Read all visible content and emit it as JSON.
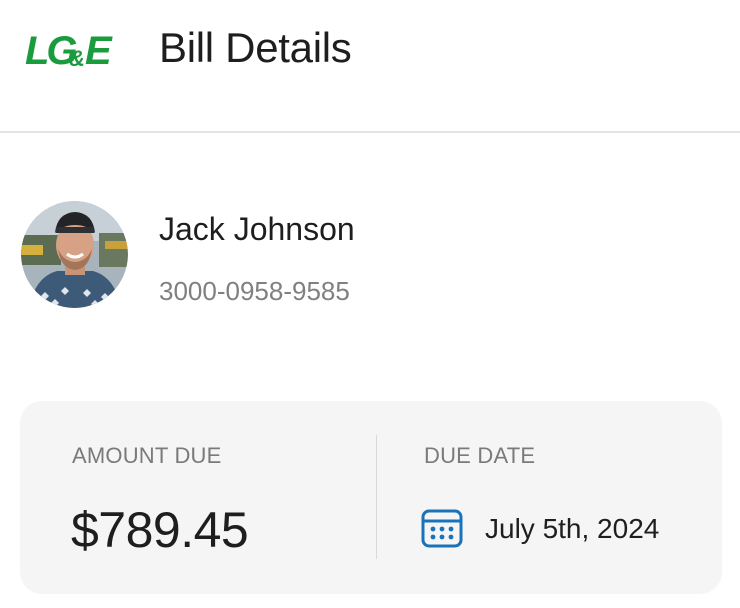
{
  "header": {
    "logo_text": "LG&E",
    "title": "Bill Details"
  },
  "profile": {
    "name": "Jack Johnson",
    "account_number": "3000-0958-9585"
  },
  "bill": {
    "amount_label": "AMOUNT DUE",
    "amount_value": "$789.45",
    "due_date_label": "DUE DATE",
    "due_date_value": "July 5th, 2024"
  },
  "icons": {
    "calendar": "calendar-icon"
  },
  "colors": {
    "brand_green": "#1a9c3e",
    "accent_blue": "#1a73b8",
    "card_background": "#f5f5f5",
    "muted_text": "#808080"
  }
}
